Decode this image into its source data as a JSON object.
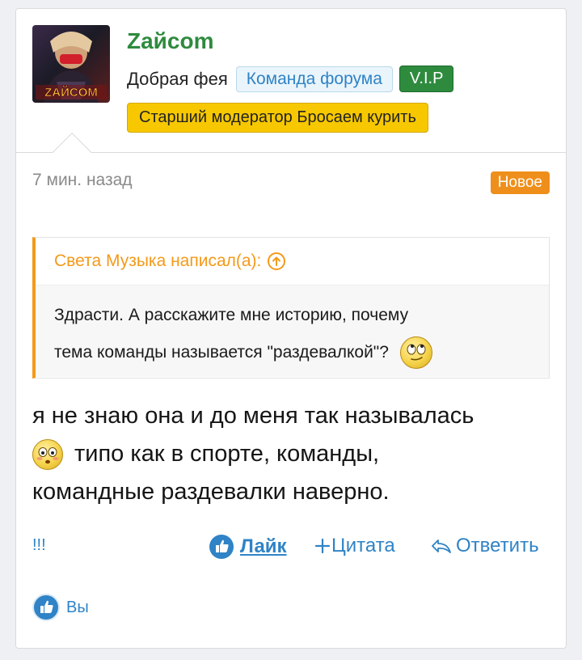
{
  "post": {
    "author": {
      "name": "Zайcom",
      "title": "Добрая фея",
      "avatar_logo_text": "ZАЙCOM",
      "badges": {
        "team": "Команда форума",
        "vip": "V.I.P",
        "moderator": "Старший модератор Бросаем курить"
      }
    },
    "timestamp": "7 мин. назад",
    "status_badge": "Новое",
    "quote": {
      "author_line": "Света Музыка написал(а):",
      "line1": "Здрасти. А расскажите мне историю, почему",
      "line2": "тема команды называется \"раздевалкой\"?",
      "smiley_icon": "rolling-eyes-smiley-icon"
    },
    "message": {
      "line1": "я не знаю она и до меня так называлась",
      "line2_after_smiley": "типо как в спорте, команды,",
      "line3": "командные раздевалки наверно.",
      "smiley_icon": "blushing-smiley-icon"
    },
    "actions": {
      "report": "!!!",
      "like": "Лайк",
      "quote": "Цитата",
      "reply": "Ответить"
    },
    "reactions": {
      "text": "Вы",
      "icon": "thumbs-up-icon"
    }
  },
  "colors": {
    "username": "#2e8b3e",
    "accent_blue": "#2f83c6",
    "quote_orange": "#f39a1a",
    "new_badge": "#ef8f1b",
    "moderator_badge": "#f7c800",
    "vip_badge": "#2e8b3e"
  }
}
